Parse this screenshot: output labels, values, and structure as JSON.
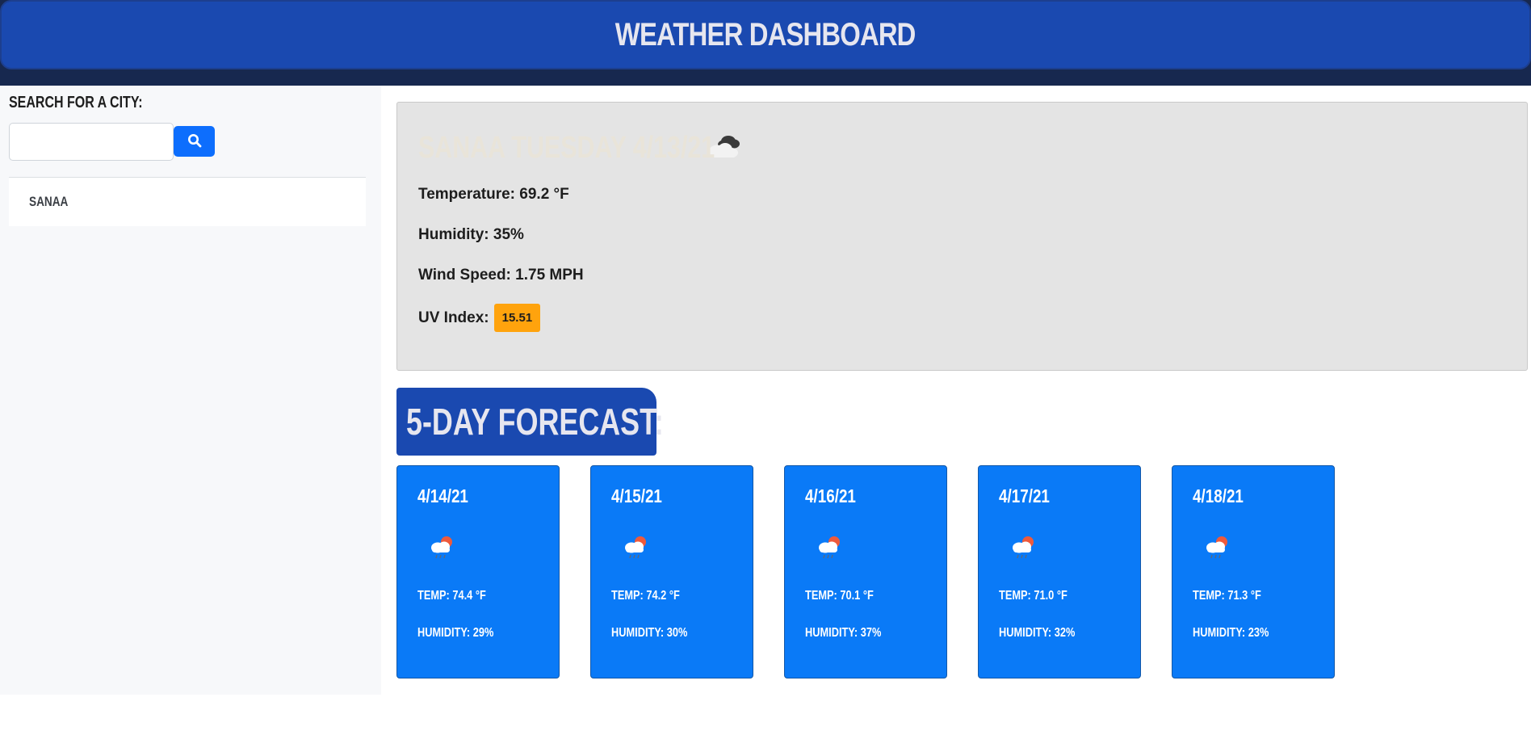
{
  "app": {
    "title": "Weather Dashboard"
  },
  "sidebar": {
    "search_label": "Search for a City:",
    "search_input_value": "",
    "search_button_icon": "search-icon",
    "history": [
      {
        "label": "Sanaa"
      }
    ]
  },
  "current": {
    "title": "Sanaa Tuesday 4/13/21",
    "icon": "broken-clouds-icon",
    "temperature": "Temperature: 69.2 °F",
    "humidity": "Humidity: 35%",
    "wind_speed": "Wind Speed: 1.75 MPH",
    "uv_label": "UV Index:",
    "uv_value": "15.51",
    "uv_color": "#ffa30d"
  },
  "forecast": {
    "heading": "5-Day Forecast:",
    "days": [
      {
        "date": "4/14/21",
        "icon": "cloud-sun-rain-icon",
        "temp": "Temp: 74.4 °F",
        "humidity": "Humidity: 29%"
      },
      {
        "date": "4/15/21",
        "icon": "cloud-sun-rain-icon",
        "temp": "Temp: 74.2 °F",
        "humidity": "Humidity: 30%"
      },
      {
        "date": "4/16/21",
        "icon": "cloud-sun-rain-icon",
        "temp": "Temp: 70.1 °F",
        "humidity": "Humidity: 37%"
      },
      {
        "date": "4/17/21",
        "icon": "cloud-sun-rain-icon",
        "temp": "Temp: 71.0 °F",
        "humidity": "Humidity: 32%"
      },
      {
        "date": "4/18/21",
        "icon": "cloud-sun-rain-icon",
        "temp": "Temp: 71.3 °F",
        "humidity": "Humidity: 23%"
      }
    ]
  },
  "colors": {
    "header_blue": "#1a49b0",
    "header_dark": "#17284f",
    "button_blue": "#0d6efd",
    "card_blue": "#0a7af7",
    "current_card_bg": "#e4e4e4"
  }
}
